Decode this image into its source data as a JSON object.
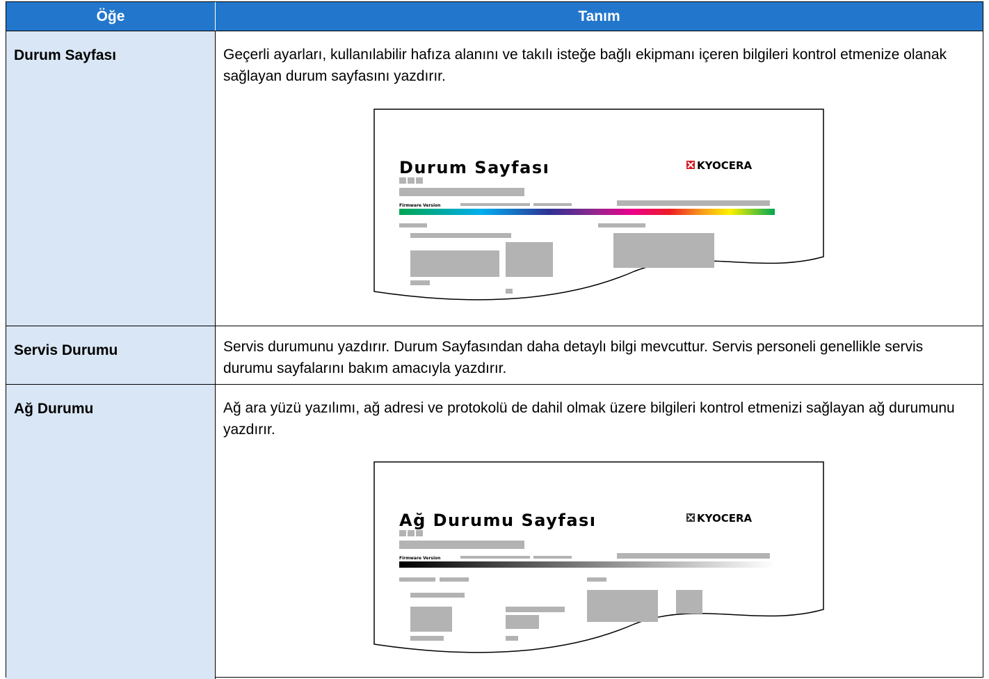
{
  "table": {
    "header": {
      "item": "Öğe",
      "definition": "Tanım"
    },
    "rows": [
      {
        "item": "Durum Sayfası",
        "description": "Geçerli ayarları, kullanılabilir hafıza alanını ve takılı isteğe bağlı ekipmanı içeren bilgileri kontrol etmenize olanak sağlayan durum sayfasını yazdırır.",
        "illustration": {
          "title": "Durum Sayfası",
          "logo": "KYOCERA",
          "firmware_label": "Firmware Version",
          "bar": "color-spectrum"
        }
      },
      {
        "item": "Servis Durumu",
        "description": "Servis durumunu yazdırır. Durum Sayfasından daha detaylı bilgi mevcuttur. Servis personeli genellikle servis durumu sayfalarını bakım amacıyla yazdırır."
      },
      {
        "item": "Ağ Durumu",
        "description": "Ağ ara yüzü yazılımı, ağ adresi ve protokolü de dahil olmak üzere bilgileri kontrol etmenizi sağlayan ağ durumunu yazdırır.",
        "illustration": {
          "title": "Ağ Durumu Sayfası",
          "logo": "KYOCERA",
          "firmware_label": "Firmware Version",
          "bar": "grayscale-gradient"
        }
      }
    ]
  },
  "colors": {
    "header_bg": "#2277cc",
    "item_bg": "#d9e6f5",
    "placeholder_gray": "#b3b3b3"
  }
}
